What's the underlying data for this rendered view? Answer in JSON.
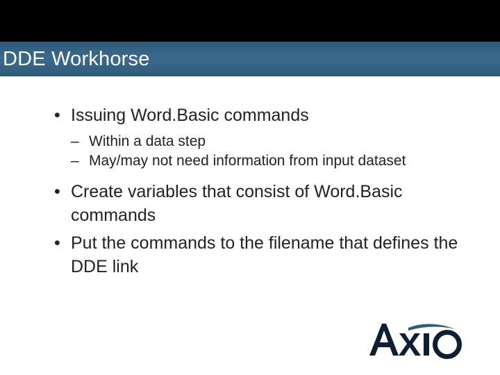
{
  "title": "DDE Workhorse",
  "bullets": {
    "b1": "Issuing Word.Basic commands",
    "b1_sub1": "Within a data step",
    "b1_sub2": "May/may not need information from input dataset",
    "b2": "Create variables that consist of Word.Basic commands",
    "b3": "Put the commands to the filename that defines the DDE link"
  },
  "logo_text": "Axio"
}
